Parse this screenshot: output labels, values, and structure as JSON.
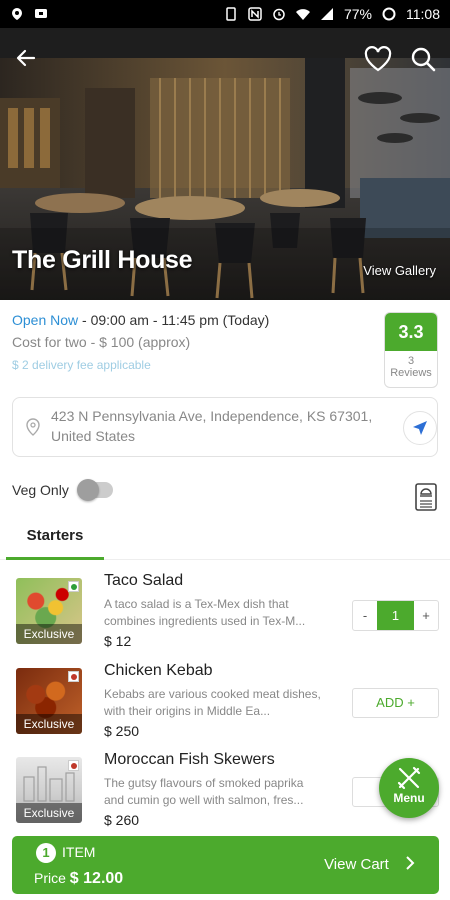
{
  "status_bar": {
    "battery": "77%",
    "time": "11:08"
  },
  "hero": {
    "title": "The Grill House",
    "view_gallery": "View Gallery"
  },
  "info": {
    "open_label": "Open Now",
    "hours": " - 09:00 am - 11:45 pm (Today)",
    "cost": "Cost for two - $ 100 (approx)",
    "delivery": "$ 2 delivery fee applicable",
    "rating": "3.3",
    "reviews_count": "3",
    "reviews_label": "Reviews"
  },
  "address": {
    "text": "423 N Pennsylvania Ave, Independence, KS 67301, United States"
  },
  "filters": {
    "veg_only_label": "Veg Only",
    "veg_only_on": false
  },
  "tabs": [
    {
      "label": "Starters",
      "active": true
    }
  ],
  "items": [
    {
      "name": "Taco Salad",
      "description": "A taco salad is a Tex-Mex dish that combines ingredients used in Tex-M...",
      "price": "$ 12",
      "badge": "Exclusive",
      "veg": true,
      "quantity": "1",
      "minus": "-",
      "plus": "+"
    },
    {
      "name": "Chicken Kebab",
      "description": "Kebabs are various cooked meat dishes, with their origins in Middle Ea...",
      "price": "$ 250",
      "badge": "Exclusive",
      "veg": false,
      "add_label": "ADD +"
    },
    {
      "name": "Moroccan Fish Skewers",
      "description": "The gutsy flavours of smoked paprika and cumin go well with salmon, fres...",
      "price": "$ 260",
      "badge": "Exclusive",
      "veg": false
    }
  ],
  "fab": {
    "label": "Menu"
  },
  "cart": {
    "count": "1",
    "item_label": "ITEM",
    "price_prefix": "Price",
    "price": "$ 12.00",
    "view_cart": "View Cart"
  },
  "colors": {
    "accent": "#4caa2d",
    "link_blue": "#2d8fd5",
    "non_veg": "#c0392b",
    "veg": "#2e9e3a"
  }
}
